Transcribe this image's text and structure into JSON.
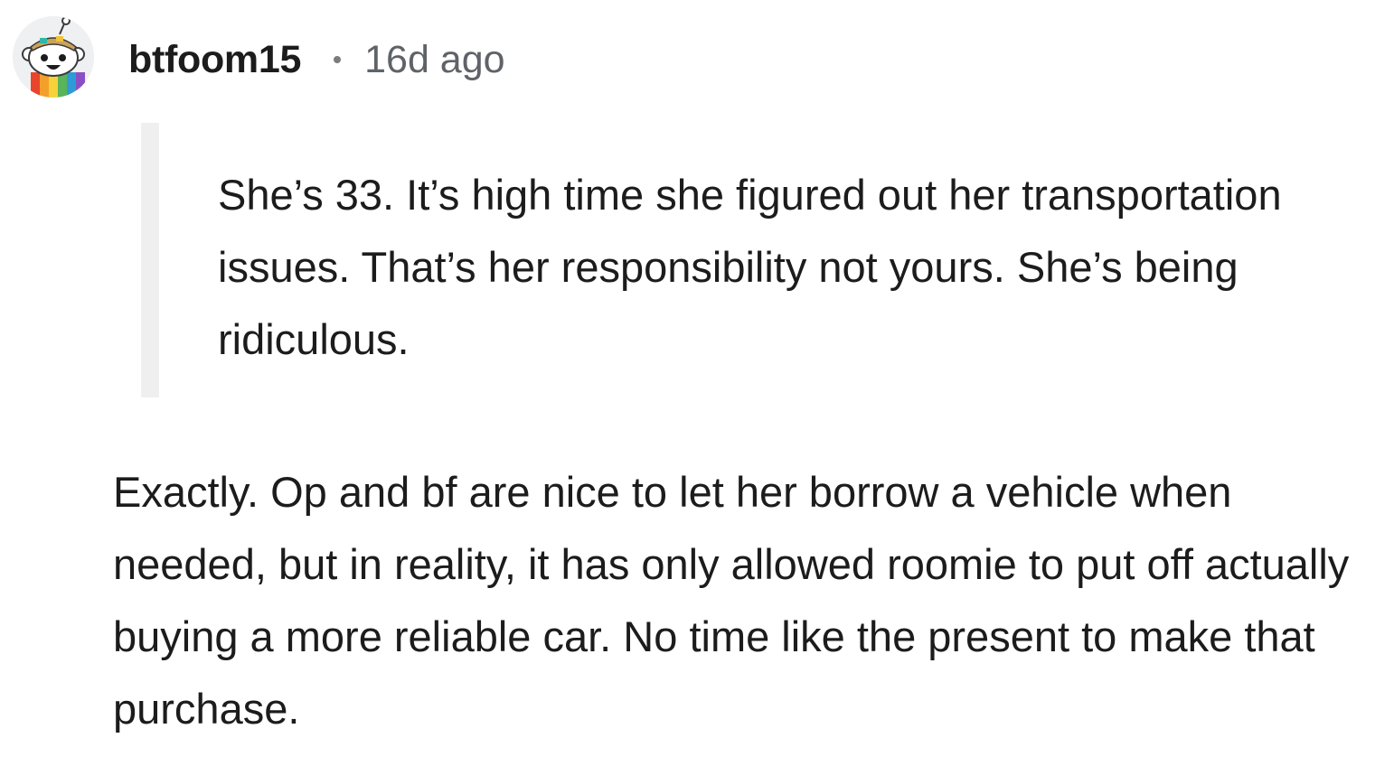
{
  "comment": {
    "avatar_icon": "snoo-avatar-icon",
    "username": "btfoom15",
    "separator": "•",
    "timestamp": "16d ago",
    "quote": "She’s 33. It’s high time she figured out her transportation issues. That’s her responsibility not yours. She’s being ridiculous.",
    "body": "Exactly. Op and bf are nice to let her borrow a vehicle when needed, but in reality, it has only allowed roomie to put off actually buying a more reliable car. No time like the present to make that purchase."
  },
  "colors": {
    "text": "#1c1c1c",
    "meta": "#5f6368",
    "quote_bar": "#efefef",
    "avatar_bg": "#eef0f2"
  }
}
